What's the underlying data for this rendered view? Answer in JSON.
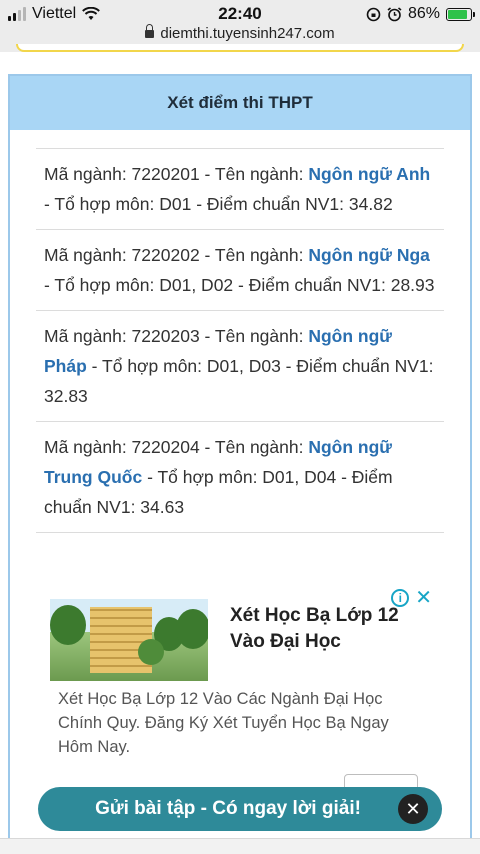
{
  "status_bar": {
    "carrier": "Viettel",
    "time": "22:40",
    "battery": "86%",
    "battery_level": 0.86,
    "url": "diemthi.tuyensinh247.com"
  },
  "card": {
    "title": "Xét điểm thi THPT",
    "items": [
      {
        "pre": "Mã ngành: 7220201 - Tên ngành: ",
        "name": "Ngôn ngữ Anh",
        "post": " - Tổ hợp môn: D01 - Điểm chuẩn NV1: 34.82"
      },
      {
        "pre": "Mã ngành: 7220202 - Tên ngành: ",
        "name": "Ngôn ngữ Nga",
        "post": " - Tổ hợp môn: D01, D02 - Điểm chuẩn NV1: 28.93"
      },
      {
        "pre": "Mã ngành: 7220203 - Tên ngành: ",
        "name": "Ngôn ngữ Pháp",
        "post": " - Tổ hợp môn: D01, D03 - Điểm chuẩn NV1: 32.83"
      },
      {
        "pre": "Mã ngành: 7220204 - Tên ngành: ",
        "name": "Ngôn ngữ Trung Quốc",
        "post": " - Tổ hợp môn: D01, D04 - Điểm chuẩn NV1: 34.63"
      }
    ]
  },
  "ad": {
    "title": "Xét Học Bạ Lớp 12 Vào Đại Học",
    "description": "Xét Học Bạ Lớp 12 Vào Các Ngành Đại Học Chính Quy. Đăng Ký Xét Tuyển Học Bạ Ngay Hôm Nay.",
    "info_icon": "i",
    "close_icon": "✕"
  },
  "floating_banner": {
    "text": "Gửi bài tập - Có ngay lời giải!",
    "close_icon": "✕"
  }
}
